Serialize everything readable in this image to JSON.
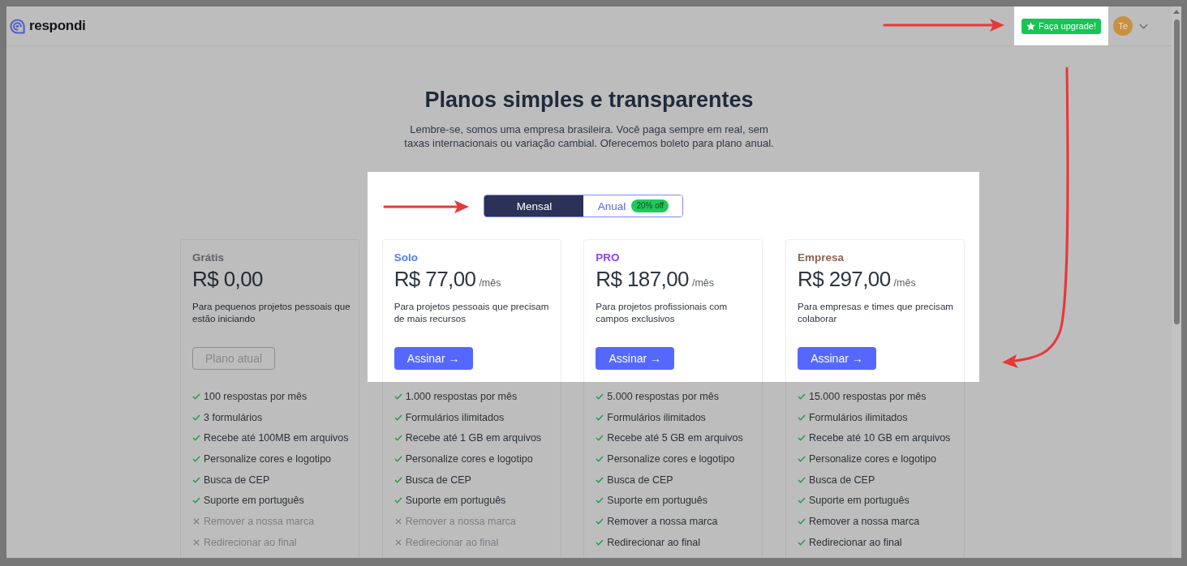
{
  "header": {
    "logo": {
      "text": "respondi"
    },
    "upgrade_button": {
      "label": "Faça upgrade!"
    },
    "avatar": {
      "initials": "Te"
    }
  },
  "heading": {
    "title": "Planos simples e transparentes",
    "subtitle": "Lembre-se, somos uma empresa brasileira. Você paga sempre em real, sem\ntaxas internacionais ou variação cambial. Oferecemos boleto para plano anual."
  },
  "billing_toggle": [
    {
      "label": "Mensal",
      "selected": true
    },
    {
      "label": "Anual",
      "selected": false,
      "badge": "20% off"
    }
  ],
  "plans": [
    {
      "name": "Grátis",
      "color": "#5c636b",
      "highlighted": false,
      "price": "R$ 0,00",
      "description": "Para pequenos projetos pessoais que estão iniciando",
      "button": {
        "kind": "current",
        "label": "Plano atual"
      },
      "features": [
        {
          "text": "100 respostas por mês",
          "included": true
        },
        {
          "text": "3 formulários",
          "included": true
        },
        {
          "text": "Recebe até 100MB em arquivos",
          "included": true
        },
        {
          "text": "Personalize cores e logotipo",
          "included": true
        },
        {
          "text": "Busca de CEP",
          "included": true
        },
        {
          "text": "Suporte em português",
          "included": true
        },
        {
          "text": "Remover a nossa marca",
          "included": false
        },
        {
          "text": "Redirecionar ao final",
          "included": false
        }
      ]
    },
    {
      "name": "Solo",
      "color": "#4d7cfe",
      "highlighted": true,
      "price": "R$ 77,00",
      "period": "/mês",
      "description": "Para projetos pessoais que precisam de mais recursos",
      "button": {
        "kind": "subscribe",
        "label": "Assinar →"
      },
      "features": [
        {
          "text": "1.000 respostas por mês",
          "included": true
        },
        {
          "text": "Formulários ilimitados",
          "included": true
        },
        {
          "text": "Recebe até 1 GB em arquivos",
          "included": true
        },
        {
          "text": "Personalize cores e logotipo",
          "included": true
        },
        {
          "text": "Busca de CEP",
          "included": true
        },
        {
          "text": "Suporte em português",
          "included": true
        },
        {
          "text": "Remover a nossa marca",
          "included": false
        },
        {
          "text": "Redirecionar ao final",
          "included": false
        }
      ]
    },
    {
      "name": "PRO",
      "color": "#8a46f5",
      "highlighted": true,
      "price": "R$ 187,00",
      "period": "/mês",
      "description": "Para projetos profissionais com campos exclusivos",
      "button": {
        "kind": "subscribe",
        "label": "Assinar →"
      },
      "features": [
        {
          "text": "5.000 respostas por mês",
          "included": true
        },
        {
          "text": "Formulários ilimitados",
          "included": true
        },
        {
          "text": "Recebe até 5 GB em arquivos",
          "included": true
        },
        {
          "text": "Personalize cores e logotipo",
          "included": true
        },
        {
          "text": "Busca de CEP",
          "included": true
        },
        {
          "text": "Suporte em português",
          "included": true
        },
        {
          "text": "Remover a nossa marca",
          "included": true
        },
        {
          "text": "Redirecionar ao final",
          "included": true
        }
      ]
    },
    {
      "name": "Empresa",
      "color": "#8a6352",
      "highlighted": true,
      "price": "R$ 297,00",
      "period": "/mês",
      "description": "Para empresas e times que precisam colaborar",
      "button": {
        "kind": "subscribe",
        "label": "Assinar →"
      },
      "features": [
        {
          "text": "15.000 respostas por mês",
          "included": true
        },
        {
          "text": "Formulários ilimitados",
          "included": true
        },
        {
          "text": "Recebe até 10 GB em arquivos",
          "included": true
        },
        {
          "text": "Personalize cores e logotipo",
          "included": true
        },
        {
          "text": "Busca de CEP",
          "included": true
        },
        {
          "text": "Suporte em português",
          "included": true
        },
        {
          "text": "Remover a nossa marca",
          "included": true
        },
        {
          "text": "Redirecionar ao final",
          "included": true
        }
      ]
    }
  ]
}
